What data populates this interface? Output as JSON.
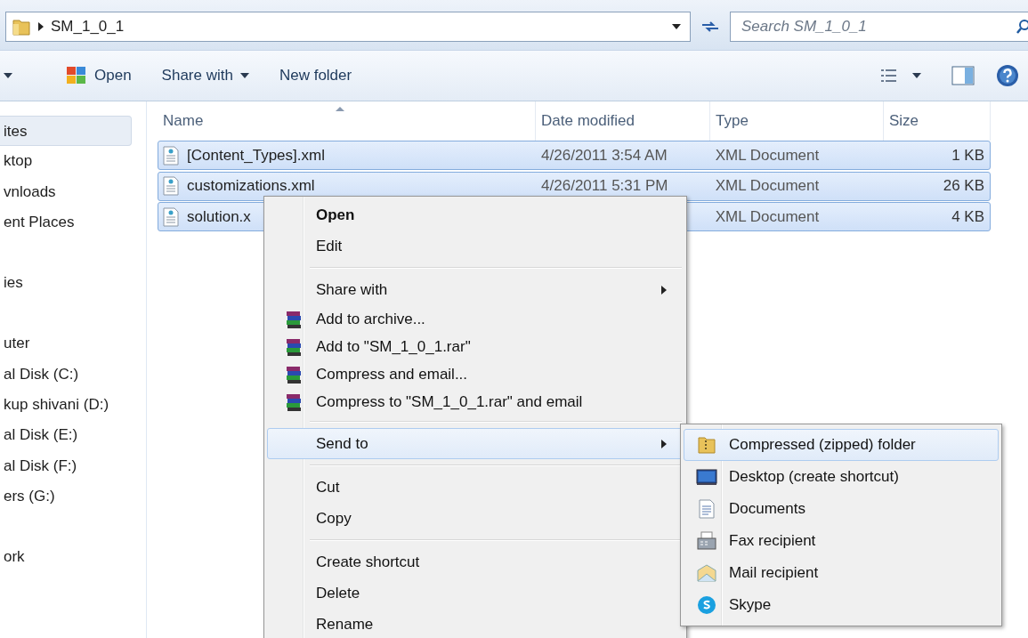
{
  "address_bar": {
    "path": "SM_1_0_1",
    "search": {
      "placeholder": "Search SM_1_0_1"
    }
  },
  "toolbar": {
    "buttons": [
      {
        "label": "Open",
        "kind": "open"
      },
      {
        "label": "Share with",
        "kind": "dropdown"
      },
      {
        "label": "New folder",
        "kind": "plain"
      }
    ]
  },
  "sidebar": {
    "groups": [
      {
        "items": [
          {
            "label": "ites",
            "selected": true
          },
          {
            "label": "ktop",
            "selected": false
          },
          {
            "label": "vnloads",
            "selected": false
          },
          {
            "label": "ent Places",
            "selected": false
          }
        ]
      },
      {
        "items": [
          {
            "label": "ies",
            "selected": false
          }
        ]
      },
      {
        "items": [
          {
            "label": "uter",
            "selected": false
          },
          {
            "label": "al Disk (C:)",
            "selected": false
          },
          {
            "label": "kup shivani (D:)",
            "selected": false
          },
          {
            "label": "al Disk (E:)",
            "selected": false
          },
          {
            "label": "al Disk (F:)",
            "selected": false
          },
          {
            "label": "ers (G:)",
            "selected": false
          }
        ]
      },
      {
        "items": [
          {
            "label": "ork",
            "selected": false
          }
        ]
      }
    ]
  },
  "file_list": {
    "columns": [
      "Name",
      "Date modified",
      "Type",
      "Size"
    ],
    "rows": [
      {
        "name": "[Content_Types].xml",
        "date": "4/26/2011 3:54 AM",
        "type": "XML Document",
        "size": "1 KB",
        "selected": true
      },
      {
        "name": "customizations.xml",
        "date": "4/26/2011 5:31 PM",
        "type": "XML Document",
        "size": "26 KB",
        "selected": true
      },
      {
        "name": "solution.x",
        "date": "",
        "type": "XML Document",
        "size": "4 KB",
        "selected": true
      }
    ]
  },
  "context_menu": {
    "items": [
      {
        "kind": "item",
        "label": "Open",
        "bold": true,
        "submenu": false,
        "selected": false
      },
      {
        "kind": "item",
        "label": "Edit",
        "bold": false,
        "submenu": false,
        "selected": false
      },
      {
        "kind": "separator"
      },
      {
        "kind": "item",
        "label": "Share with",
        "bold": false,
        "submenu": true,
        "selected": false
      },
      {
        "kind": "archive",
        "label": "Add to archive...",
        "bold": false,
        "submenu": false,
        "selected": false
      },
      {
        "kind": "archive",
        "label": "Add to \"SM_1_0_1.rar\"",
        "bold": false,
        "submenu": false,
        "selected": false
      },
      {
        "kind": "archive",
        "label": "Compress and email...",
        "bold": false,
        "submenu": false,
        "selected": false
      },
      {
        "kind": "archive",
        "label": "Compress to \"SM_1_0_1.rar\" and email",
        "bold": false,
        "submenu": false,
        "selected": false
      },
      {
        "kind": "separator"
      },
      {
        "kind": "item",
        "label": "Send to",
        "bold": false,
        "submenu": true,
        "selected": true
      },
      {
        "kind": "separator"
      },
      {
        "kind": "item",
        "label": "Cut",
        "bold": false,
        "submenu": false,
        "selected": false
      },
      {
        "kind": "item",
        "label": "Copy",
        "bold": false,
        "submenu": false,
        "selected": false
      },
      {
        "kind": "separator"
      },
      {
        "kind": "item",
        "label": "Create shortcut",
        "bold": false,
        "submenu": false,
        "selected": false
      },
      {
        "kind": "item",
        "label": "Delete",
        "bold": false,
        "submenu": false,
        "selected": false
      },
      {
        "kind": "item",
        "label": "Rename",
        "bold": false,
        "submenu": false,
        "selected": false
      }
    ]
  },
  "send_to_menu": {
    "items": [
      {
        "label": "Compressed (zipped) folder",
        "kind": "zip",
        "selected": true
      },
      {
        "label": "Desktop (create shortcut)",
        "kind": "desktop",
        "selected": false
      },
      {
        "label": "Documents",
        "kind": "document",
        "selected": false
      },
      {
        "label": "Fax recipient",
        "kind": "fax",
        "selected": false
      },
      {
        "label": "Mail recipient",
        "kind": "mail",
        "selected": false
      },
      {
        "label": "Skype",
        "kind": "skype",
        "selected": false
      }
    ]
  }
}
